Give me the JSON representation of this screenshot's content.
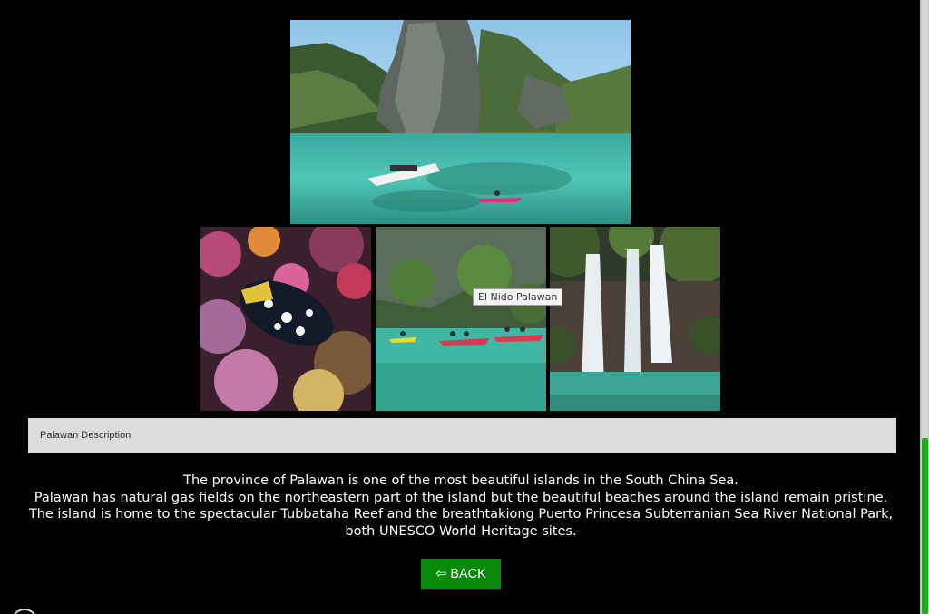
{
  "gallery": {
    "main_photo_icon": "lagoon-cliffs-boat-photo",
    "reef_photo_icon": "coral-reef-triggerfish-photo",
    "kayak_photo_icon": "el-nido-kayaks-photo",
    "falls_photo_icon": "waterfall-photo",
    "tooltip": "El Nido Palawan"
  },
  "description": {
    "header": "Palawan Description",
    "lines": [
      "The province of Palawan is one of the most beautiful islands in the South China Sea.",
      "Palawan has natural gas fields on the northeastern part of the island but the beautiful beaches around the island remain pristine.",
      "The island is home to the spectacular Tubbataha Reef and the breathtakiong Puerto Princesa Subterranian Sea River National Park,",
      "both UNESCO World Heritage sites."
    ]
  },
  "navigation": {
    "back_label": "⇦ BACK"
  },
  "colors": {
    "background": "#000000",
    "button": "#0a8a0a",
    "description_bar": "#dcdcdc",
    "scrollbar_thumb": "#22a81e"
  }
}
